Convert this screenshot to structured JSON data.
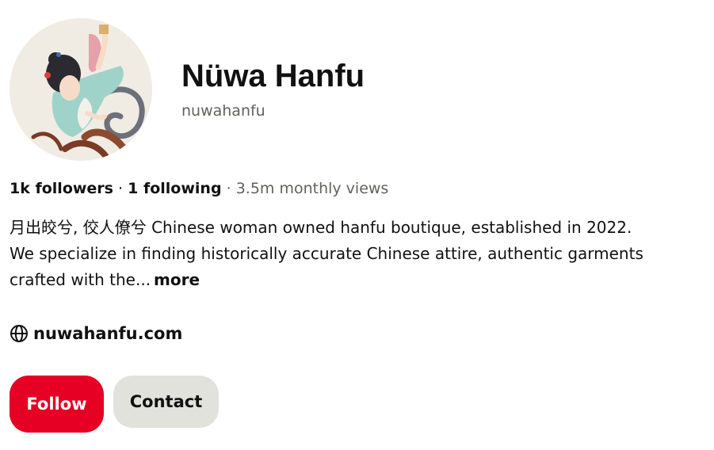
{
  "profile": {
    "name": "Nüwa Hanfu",
    "username": "nuwahanfu",
    "avatar_icon": "painted-portrait-avatar"
  },
  "stats": {
    "followers": "1k followers",
    "separator1": " · ",
    "following": "1 following",
    "separator2": " · ",
    "monthly_views": "3.5m monthly views"
  },
  "bio": {
    "text_line1": "月出皎兮, 佼人僚兮 Chinese woman owned hanfu boutique, established in 2022.",
    "text_line2": "We specialize in finding historically accurate Chinese attire, authentic garments",
    "text_line3": "crafted with the...",
    "more_label": "more"
  },
  "website": {
    "icon": "globe-icon",
    "label": "nuwahanfu.com"
  },
  "actions": {
    "follow_label": "Follow",
    "contact_label": "Contact"
  },
  "colors": {
    "follow_bg": "#e60023",
    "contact_bg": "#e2e2dc",
    "muted_text": "#62625b"
  }
}
